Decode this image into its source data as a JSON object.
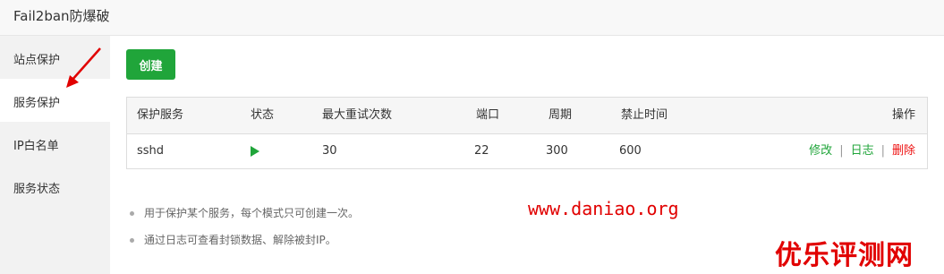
{
  "window": {
    "title": "Fail2ban防爆破"
  },
  "sidebar": {
    "items": [
      {
        "label": "站点保护",
        "active": false
      },
      {
        "label": "服务保护",
        "active": true
      },
      {
        "label": "IP白名单",
        "active": false
      },
      {
        "label": "服务状态",
        "active": false
      }
    ]
  },
  "toolbar": {
    "create_label": "创建"
  },
  "table": {
    "headers": [
      "保护服务",
      "状态",
      "最大重试次数",
      "端口",
      "周期",
      "禁止时间",
      "操作"
    ],
    "rows": [
      {
        "service": "sshd",
        "status_icon": "play-icon",
        "max_retry": "30",
        "port": "22",
        "period": "300",
        "ban_time": "600",
        "actions": {
          "edit": "修改",
          "log": "日志",
          "delete": "删除",
          "separator": "|"
        }
      }
    ]
  },
  "notes": [
    "用于保护某个服务，每个模式只可创建一次。",
    "通过日志可查看封锁数据、解除被封IP。"
  ],
  "watermark": {
    "url": "www.daniao.org",
    "brand": "优乐评测网"
  },
  "colors": {
    "accent": "#20a53a",
    "danger": "#e11111",
    "watermark": "#e10000"
  }
}
